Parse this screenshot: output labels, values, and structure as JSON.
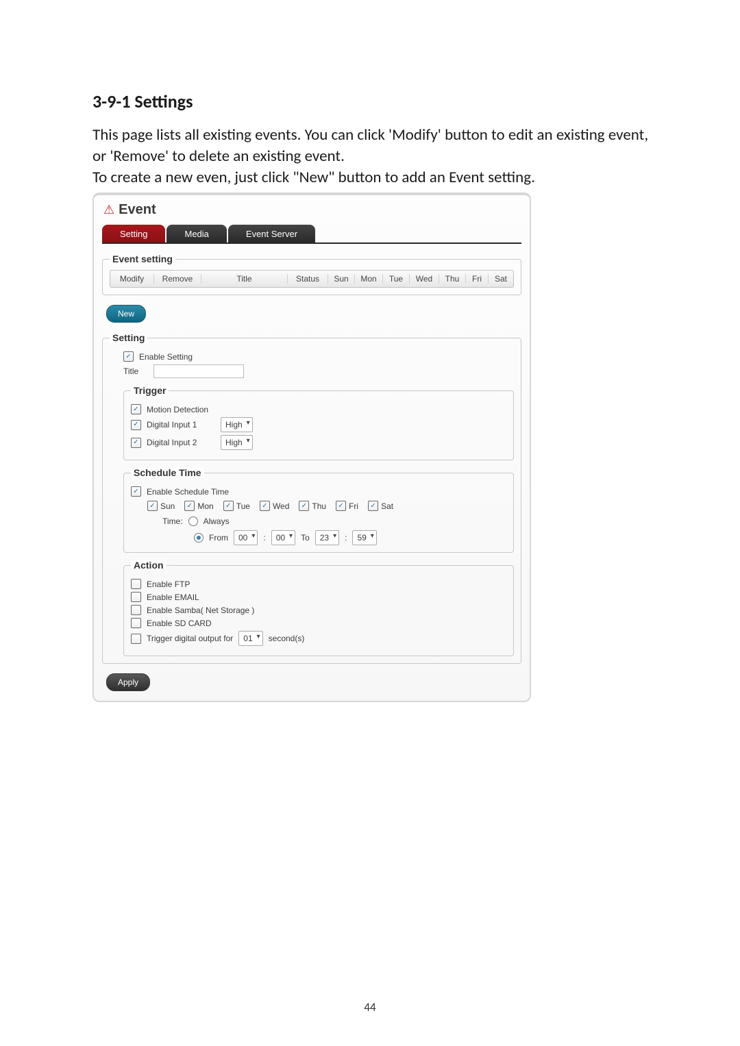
{
  "heading": "3-9-1 Settings",
  "intro_line1": "This page lists all existing events. You can click 'Modify' button to edit an existing event, or 'Remove' to delete an existing event.",
  "intro_line2": "To create a new even, just click \"New\" button to add an Event setting.",
  "panel": {
    "title": "Event",
    "tabs": {
      "setting": "Setting",
      "media": "Media",
      "eventserver": "Event Server"
    },
    "eventsetting_legend": "Event setting",
    "columns": {
      "modify": "Modify",
      "remove": "Remove",
      "title": "Title",
      "status": "Status",
      "sun": "Sun",
      "mon": "Mon",
      "tue": "Tue",
      "wed": "Wed",
      "thu": "Thu",
      "fri": "Fri",
      "sat": "Sat"
    },
    "new_btn": "New",
    "setting_legend": "Setting",
    "enable_setting": "Enable Setting",
    "title_label": "Title",
    "trigger_legend": "Trigger",
    "trigger": {
      "motion": "Motion Detection",
      "di1": "Digital Input 1",
      "di1_val": "High",
      "di2": "Digital Input 2",
      "di2_val": "High"
    },
    "schedule_legend": "Schedule Time",
    "enable_schedule": "Enable Schedule Time",
    "days": {
      "sun": "Sun",
      "mon": "Mon",
      "tue": "Tue",
      "wed": "Wed",
      "thu": "Thu",
      "fri": "Fri",
      "sat": "Sat"
    },
    "time_label": "Time:",
    "always": "Always",
    "from": "From",
    "to": "To",
    "from_h": "00",
    "from_m": "00",
    "to_h": "23",
    "to_m": "59",
    "colon": ":",
    "action_legend": "Action",
    "action": {
      "ftp": "Enable FTP",
      "email": "Enable EMAIL",
      "samba": "Enable Samba( Net Storage )",
      "sd": "Enable SD CARD",
      "trigger_out_pre": "Trigger digital output for",
      "trigger_out_val": "01",
      "trigger_out_post": "second(s)"
    },
    "apply_btn": "Apply"
  },
  "page_number": "44"
}
